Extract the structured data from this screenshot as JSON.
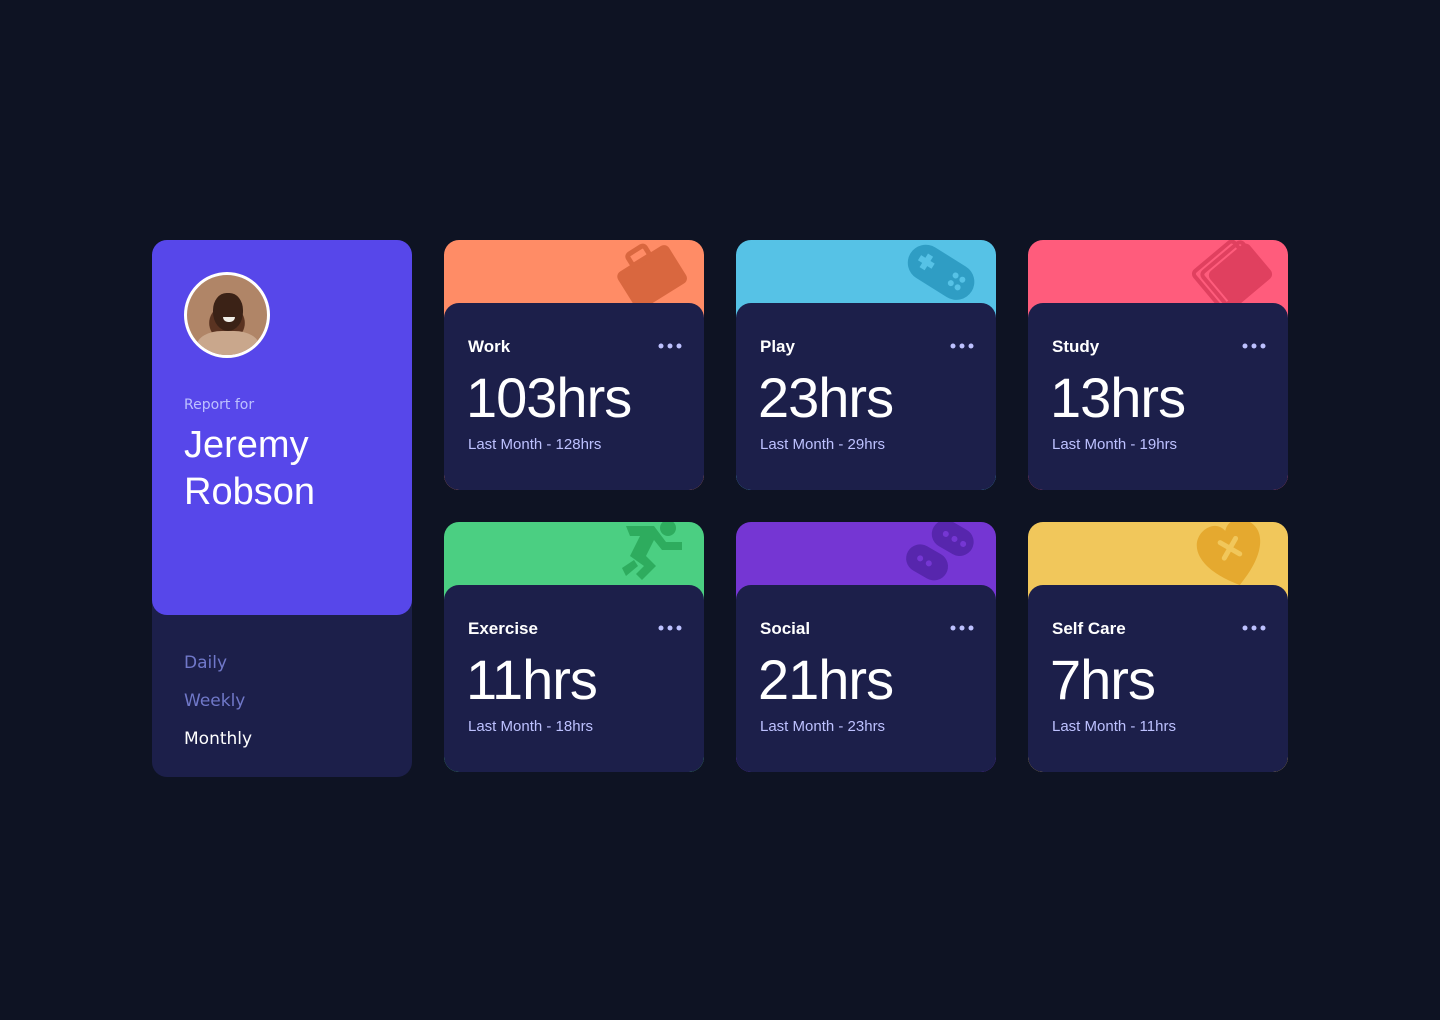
{
  "profile": {
    "report_for": "Report for",
    "name": "Jeremy Robson",
    "avatar": "avatar-photo"
  },
  "periods": {
    "daily": "Daily",
    "weekly": "Weekly",
    "monthly": "Monthly",
    "selected": "Monthly"
  },
  "activities": [
    {
      "title": "Work",
      "current": "103hrs",
      "previous": "Last Month - 128hrs",
      "color": "#ff8c66",
      "icon": "briefcase-icon"
    },
    {
      "title": "Play",
      "current": "23hrs",
      "previous": "Last Month - 29hrs",
      "color": "#56c2e6",
      "icon": "gamepad-icon"
    },
    {
      "title": "Study",
      "current": "13hrs",
      "previous": "Last Month - 19hrs",
      "color": "#ff5c7c",
      "icon": "book-icon"
    },
    {
      "title": "Exercise",
      "current": "11hrs",
      "previous": "Last Month - 18hrs",
      "color": "#4bcf82",
      "icon": "running-icon"
    },
    {
      "title": "Social",
      "current": "21hrs",
      "previous": "Last Month - 23hrs",
      "color": "#7536d3",
      "icon": "speech-bubble-icon"
    },
    {
      "title": "Self Care",
      "current": "7hrs",
      "previous": "Last Month - 11hrs",
      "color": "#f1c75b",
      "icon": "heart-icon"
    }
  ],
  "colors": {
    "background": "#0e1323",
    "card": "#1c1f4a",
    "accent": "#5747ea",
    "muted_text": "#bdc1ff"
  }
}
